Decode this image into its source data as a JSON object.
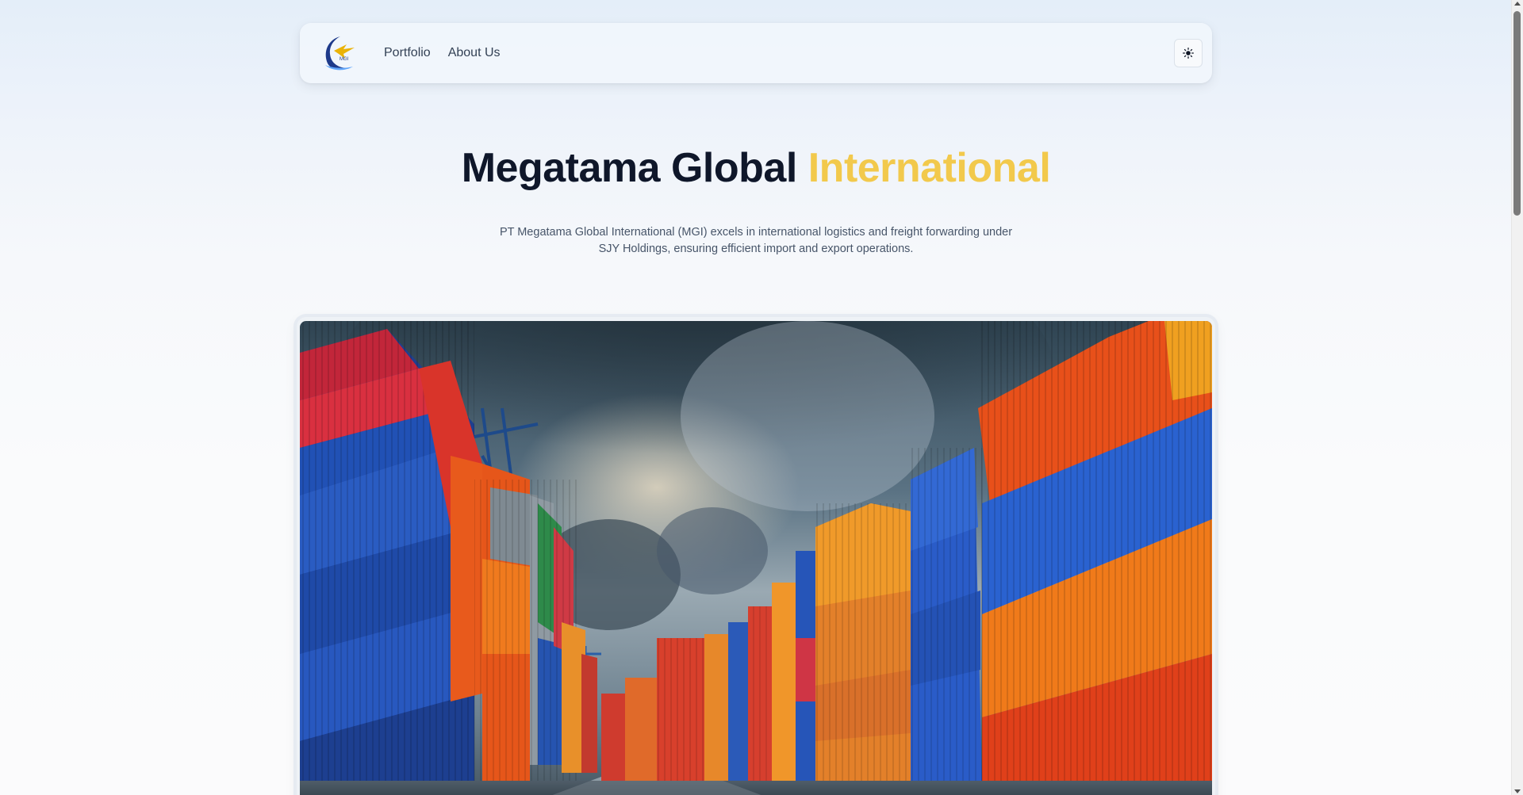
{
  "nav": {
    "logo_text": "MGI",
    "links": [
      {
        "label": "Portfolio"
      },
      {
        "label": "About Us"
      }
    ],
    "theme_toggle_icon": "sun-icon"
  },
  "hero": {
    "title_main": "Megatama Global",
    "title_accent": "International",
    "description": "PT Megatama Global International (MGI) excels in international logistics and freight forwarding under SJY Holdings, ensuring efficient import and export operations.",
    "image_alt": "Stacks of colorful shipping containers at a port under a cloudy sky"
  },
  "colors": {
    "accent": "#f2c94c",
    "title": "#0f172a",
    "text": "#475569"
  }
}
